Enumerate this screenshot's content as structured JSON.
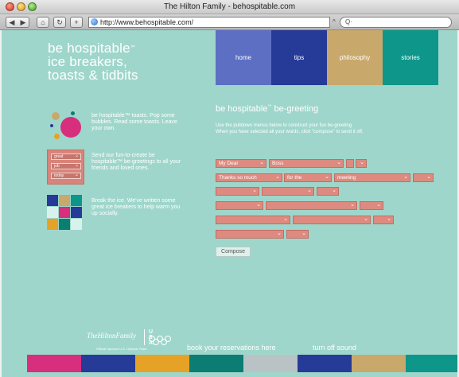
{
  "window": {
    "title": "The Hilton Family - behospitable.com",
    "url": "http://www.behospitable.com/",
    "search_placeholder": "Q"
  },
  "logo": {
    "line1": "be hospitable",
    "tm": "™",
    "line2": "ice breakers,",
    "line3": "toasts & tidbits"
  },
  "nav": [
    {
      "label": "home",
      "color": "#5d6fc3"
    },
    {
      "label": "tips",
      "color": "#263a98"
    },
    {
      "label": "philosophy",
      "color": "#c9a86c"
    },
    {
      "label": "stories",
      "color": "#0e968a"
    }
  ],
  "features": {
    "toasts": "be hospitable™ toasts. Pop some bubbles. Read some toasts. Leave your own.",
    "greetings": "Send our fun-to-create be hospitable™ be-greetings to all your friends and loved ones.",
    "icebreakers": "Break the ice. We've written some great ice breakers to help warm you up socially.",
    "mini_selects": [
      "great",
      "job",
      "today"
    ]
  },
  "greeting": {
    "title": "be hospitable",
    "title_rest": " be-greeting",
    "tm": "™",
    "description": "Use the pulldown menus below to construct your fun be-greeting. When you have selected all your words, click \"compose\" to send it off.",
    "rows": [
      [
        "My Dear",
        "Boss",
        "",
        ""
      ],
      [
        "Thanks so much",
        "for the",
        "meeting",
        ""
      ],
      [
        "",
        "",
        ""
      ],
      [
        "",
        "",
        ""
      ],
      [
        "",
        "",
        ""
      ],
      [
        "",
        ""
      ]
    ],
    "compose_label": "Compose"
  },
  "footer": {
    "brand": "TheHiltonFamily",
    "usa": "U S A",
    "sponsor": "Official Sponsor U.S. Olympic Team",
    "book_link": "book your reservations here",
    "sound_link": "turn off sound",
    "strip_colors": [
      "#d72e7e",
      "#263a98",
      "#e5a226",
      "#0b7d73",
      "#b9c3c6",
      "#263a98",
      "#c9a86c",
      "#0e968a"
    ]
  }
}
